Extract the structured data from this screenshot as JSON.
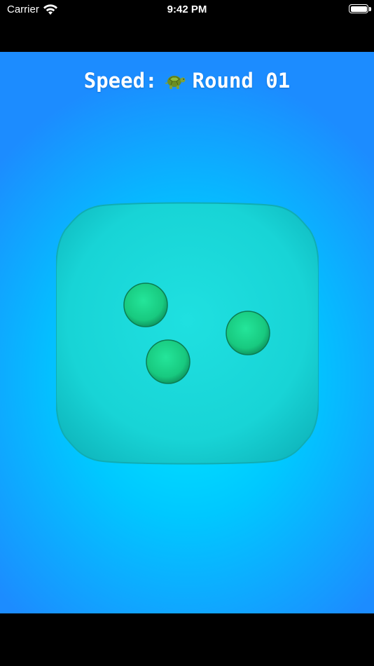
{
  "status_bar": {
    "carrier": "Carrier",
    "time": "9:42 PM",
    "icons": [
      "wifi-icon",
      "battery-icon"
    ]
  },
  "hud": {
    "speed_label": "Speed:",
    "speed_icon": "turtle-icon",
    "round_label": "Round 01"
  },
  "die": {
    "face_value": 3,
    "face_color": "#19d2d4",
    "pip_color": "#1ecf86"
  },
  "colors": {
    "background_center": "#00ecff",
    "background_edge": "#1c8cff"
  }
}
